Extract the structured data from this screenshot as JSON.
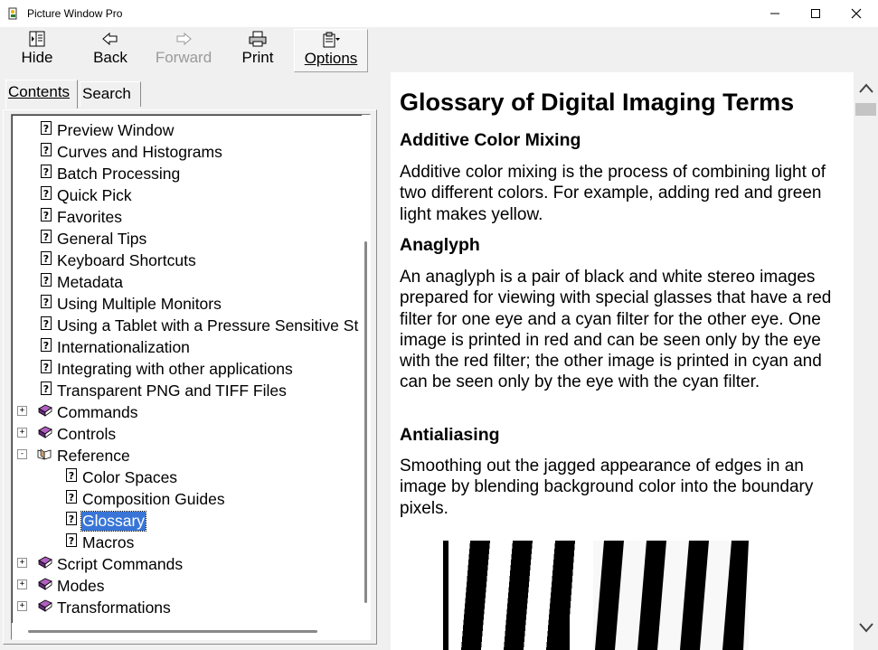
{
  "window": {
    "title": "Picture Window Pro"
  },
  "toolbar": {
    "hide": "Hide",
    "back": "Back",
    "forward": "Forward",
    "print": "Print",
    "options": "Options"
  },
  "tabs": {
    "contents": "Contents",
    "search": "Search"
  },
  "tree": {
    "items": [
      {
        "label": "Preview Window",
        "type": "page",
        "level": 1
      },
      {
        "label": "Curves and Histograms",
        "type": "page",
        "level": 1
      },
      {
        "label": "Batch Processing",
        "type": "page",
        "level": 1
      },
      {
        "label": "Quick Pick",
        "type": "page",
        "level": 1
      },
      {
        "label": "Favorites",
        "type": "page",
        "level": 1
      },
      {
        "label": "General Tips",
        "type": "page",
        "level": 1
      },
      {
        "label": "Keyboard Shortcuts",
        "type": "page",
        "level": 1
      },
      {
        "label": "Metadata",
        "type": "page",
        "level": 1
      },
      {
        "label": "Using Multiple Monitors",
        "type": "page",
        "level": 1
      },
      {
        "label": "Using a Tablet with a Pressure Sensitive St",
        "type": "page",
        "level": 1
      },
      {
        "label": "Internationalization",
        "type": "page",
        "level": 1
      },
      {
        "label": "Integrating with other applications",
        "type": "page",
        "level": 1
      },
      {
        "label": "Transparent PNG and TIFF Files",
        "type": "page",
        "level": 1
      },
      {
        "label": "Commands",
        "type": "book",
        "level": 1,
        "expander": "+"
      },
      {
        "label": "Controls",
        "type": "book",
        "level": 1,
        "expander": "+"
      },
      {
        "label": "Reference",
        "type": "book-open",
        "level": 1,
        "expander": "-"
      },
      {
        "label": "Color Spaces",
        "type": "page",
        "level": 2
      },
      {
        "label": "Composition Guides",
        "type": "page",
        "level": 2
      },
      {
        "label": "Glossary",
        "type": "page",
        "level": 2,
        "selected": true
      },
      {
        "label": "Macros",
        "type": "page",
        "level": 2
      },
      {
        "label": "Script Commands",
        "type": "book",
        "level": 1,
        "expander": "+"
      },
      {
        "label": "Modes",
        "type": "book",
        "level": 1,
        "expander": "+"
      },
      {
        "label": "Transformations",
        "type": "book",
        "level": 1,
        "expander": "+"
      }
    ]
  },
  "content": {
    "title": "Glossary of Digital Imaging Terms",
    "sections": [
      {
        "heading": "Additive Color Mixing",
        "body": "Additive color mixing is the process of combining light of two different colors. For example, adding red and green light makes yellow."
      },
      {
        "heading": "Anaglyph",
        "body": "An anaglyph is a pair of black and white stereo images prepared for viewing with special glasses that have a red filter for one eye and a cyan filter for the other eye. One image is printed in red and can be seen only by the eye with the red filter; the other image is printed in cyan and can be seen only by the eye with the cyan filter."
      },
      {
        "heading": "Antialiasing",
        "body": "Smoothing out the jagged appearance of edges in an image by blending background color into the boundary pixels."
      }
    ]
  },
  "colors": {
    "selection": "#3875d7",
    "disabled": "#9a9a9a"
  }
}
